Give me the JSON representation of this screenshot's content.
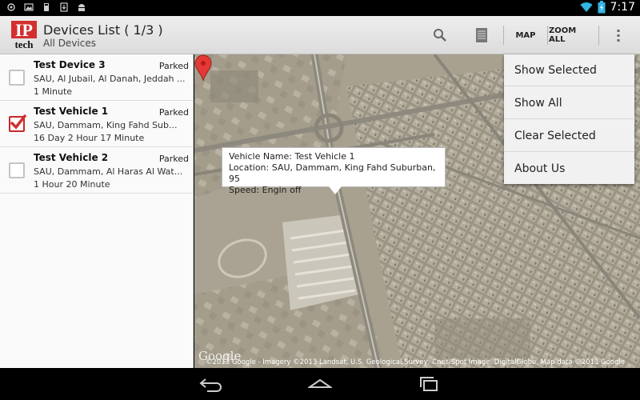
{
  "status_bar": {
    "time": "7:17",
    "icons_left": [
      "gps-icon",
      "image-icon",
      "sd-card-icon",
      "download-icon",
      "android-icon"
    ],
    "icons_right": [
      "wifi-icon",
      "battery-icon"
    ]
  },
  "action_bar": {
    "logo_text_top": "IP",
    "logo_text_bottom": "tech",
    "title": "Devices List ( 1/3 )",
    "subtitle": "All Devices",
    "map_label": "MAP",
    "zoom_all_label": "ZOOM ALL",
    "icons": [
      "search-icon",
      "list-icon",
      "overflow-icon"
    ]
  },
  "devices": [
    {
      "name": "Test Device 3",
      "status": "Parked",
      "location": "SAU, Al Jubail, Al Danah, Jeddah ...",
      "duration": "1 Minute",
      "checked": false
    },
    {
      "name": "Test Vehicle 1",
      "status": "Parked",
      "location": "SAU, Dammam, King Fahd Sub...",
      "duration": "16 Day 2 Hour 17 Minute",
      "checked": true
    },
    {
      "name": "Test Vehicle 2",
      "status": "Parked",
      "location": "SAU, Dammam, Al Haras Al Wat...",
      "duration": "1 Hour 20 Minute",
      "checked": false
    }
  ],
  "map": {
    "callout": {
      "line1": "Vehicle Name: Test Vehicle 1",
      "line2": "Location: SAU, Dammam, King Fahd Suburban, 95",
      "line3": "Speed: Engin off"
    },
    "google_logo": "Google",
    "attribution": "©2013 Google - Imagery ©2013 Landsat, U.S. Geological Survey, Cnes/Spot Image, DigitalGlobe, Map data ©2013 Google"
  },
  "menu": {
    "items": [
      "Show Selected",
      "Show All",
      "Clear Selected",
      "About Us"
    ]
  },
  "nav_bar": {
    "icons": [
      "back-icon",
      "home-icon",
      "recent-apps-icon"
    ]
  },
  "colors": {
    "accent": "#d32f2f",
    "marker": "#e53935"
  }
}
